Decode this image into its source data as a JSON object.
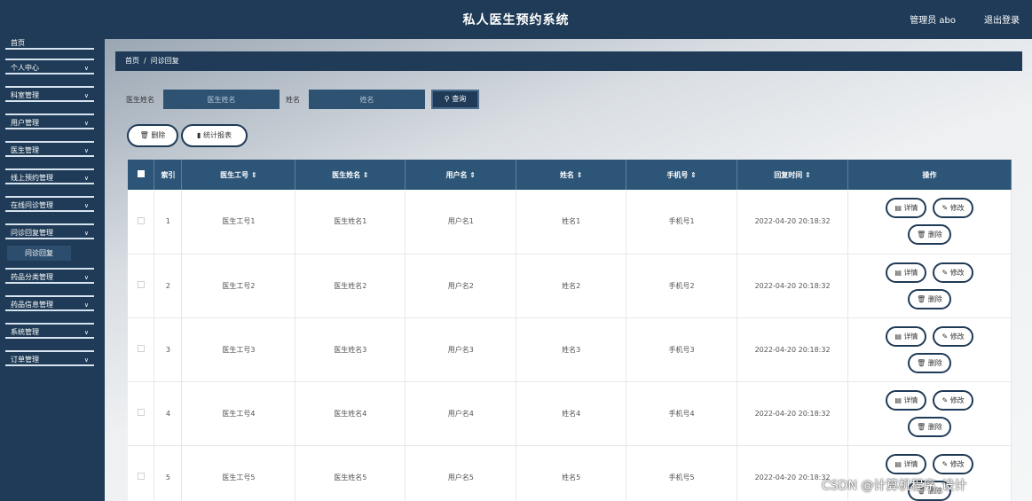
{
  "header": {
    "title": "私人医生预约系统",
    "user": "管理员 abo",
    "logout": "退出登录"
  },
  "sidebar": {
    "top_label": "首页",
    "items": [
      {
        "label": "个人中心"
      },
      {
        "label": "科室管理"
      },
      {
        "label": "用户管理"
      },
      {
        "label": "医生管理"
      },
      {
        "label": "线上预约管理"
      },
      {
        "label": "在线问诊管理"
      },
      {
        "label": "问诊回复管理"
      },
      {
        "label": "药品分类管理"
      },
      {
        "label": "药品信息管理"
      },
      {
        "label": "系统管理"
      },
      {
        "label": "订单管理"
      }
    ],
    "sub_item": "问诊回复",
    "chevron": "chevron-down-icon"
  },
  "breadcrumb": {
    "home": "首页",
    "separator": "/",
    "current": "问诊回复"
  },
  "search": {
    "doctor_name_label": "医生姓名",
    "doctor_name_placeholder": "医生姓名",
    "name_label": "姓名",
    "name_placeholder": "姓名",
    "query_label": "查询",
    "query_icon": "search-icon"
  },
  "actions": {
    "delete_label": "删除",
    "stats_label": "统计报表"
  },
  "table": {
    "headers": {
      "index": "索引",
      "doctor_no": "医生工号 ⇕",
      "doctor_name": "医生姓名 ⇕",
      "username": "用户名 ⇕",
      "name": "姓名 ⇕",
      "phone": "手机号 ⇕",
      "reply_time": "回复时间 ⇕",
      "ops": "操作"
    },
    "op_labels": {
      "detail": "详情",
      "edit": "修改",
      "delete": "删除"
    },
    "rows": [
      {
        "index": "1",
        "doctor_no": "医生工号1",
        "doctor_name": "医生姓名1",
        "username": "用户名1",
        "name": "姓名1",
        "phone": "手机号1",
        "reply_time": "2022-04-20 20:18:32"
      },
      {
        "index": "2",
        "doctor_no": "医生工号2",
        "doctor_name": "医生姓名2",
        "username": "用户名2",
        "name": "姓名2",
        "phone": "手机号2",
        "reply_time": "2022-04-20 20:18:32"
      },
      {
        "index": "3",
        "doctor_no": "医生工号3",
        "doctor_name": "医生姓名3",
        "username": "用户名3",
        "name": "姓名3",
        "phone": "手机号3",
        "reply_time": "2022-04-20 20:18:32"
      },
      {
        "index": "4",
        "doctor_no": "医生工号4",
        "doctor_name": "医生姓名4",
        "username": "用户名4",
        "name": "姓名4",
        "phone": "手机号4",
        "reply_time": "2022-04-20 20:18:32"
      },
      {
        "index": "5",
        "doctor_no": "医生工号5",
        "doctor_name": "医生姓名5",
        "username": "用户名5",
        "name": "姓名5",
        "phone": "手机号5",
        "reply_time": "2022-04-20 20:18:32"
      }
    ]
  },
  "watermark": "CSDN @计算机程序_设计",
  "colors": {
    "primary": "#1f3b57",
    "header_row": "#2c5578",
    "input_bg": "#2e5272"
  }
}
